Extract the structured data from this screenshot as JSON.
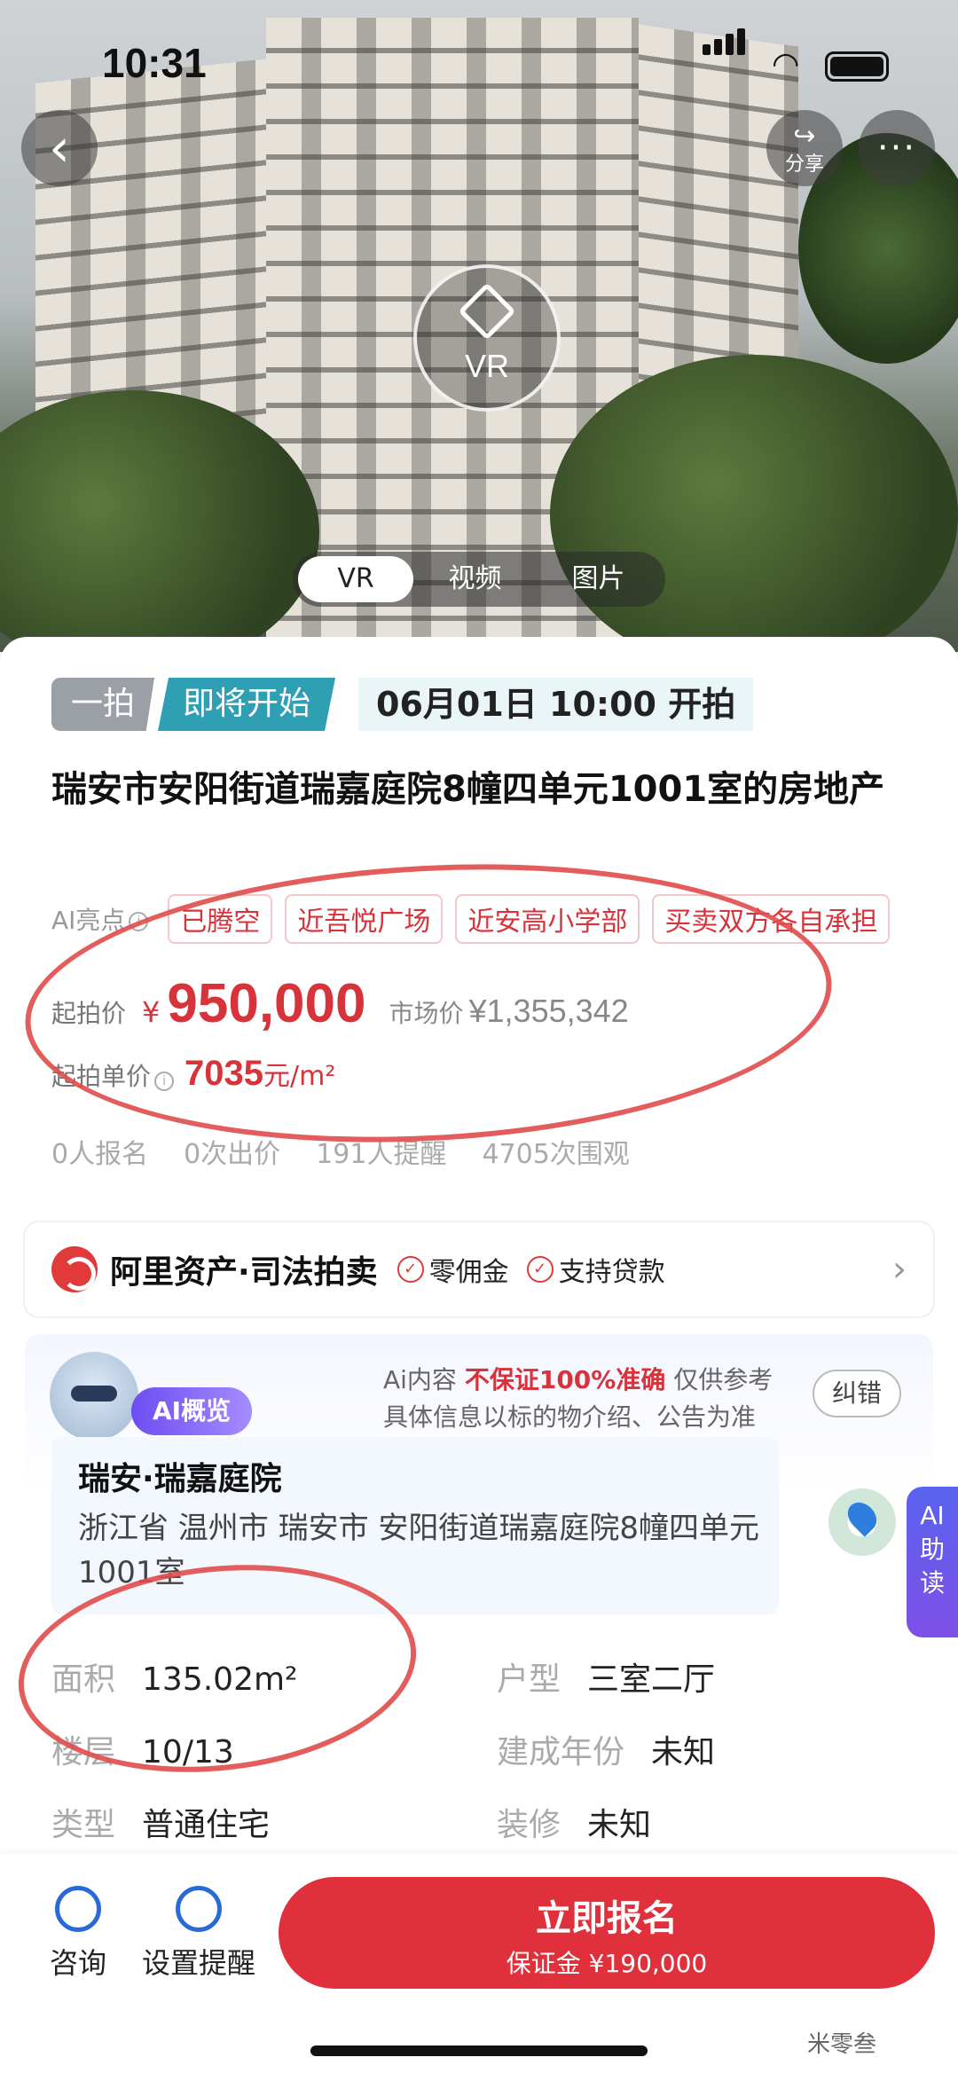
{
  "status_bar": {
    "time": "10:31"
  },
  "hero": {
    "share_label": "分享",
    "more_label": "···",
    "vr_label": "VR",
    "tabs": [
      {
        "label": "VR"
      },
      {
        "label": "视频"
      },
      {
        "label": "图片"
      }
    ]
  },
  "auction": {
    "round_tag": "一拍",
    "status_tag": "即将开始",
    "start_time": "06月01日 10:00 开拍",
    "title": "瑞安市安阳街道瑞嘉庭院8幢四单元1001室的房地产",
    "highlights_label": "AI亮点",
    "highlights": [
      "已腾空",
      "近吾悦广场",
      "近安高小学部",
      "买卖双方各自承担"
    ],
    "start_price_label": "起拍价",
    "currency": "¥",
    "start_price": "950,000",
    "market_price_label": "市场价",
    "market_price": "¥1,355,342",
    "unit_price_label": "起拍单价",
    "unit_price": "7035",
    "unit_price_unit": "元/m²",
    "stats": [
      "0人报名",
      "0次出价",
      "191人提醒",
      "4705次围观"
    ]
  },
  "platform": {
    "brand": "阿里资产·司法拍卖",
    "features": [
      "零佣金",
      "支持贷款"
    ]
  },
  "ai_overview": {
    "badge": "AI概览",
    "note_prefix": "Ai内容",
    "note_emph": "不保证100%准确",
    "note_suffix": "仅供参考",
    "note_line2": "具体信息以标的物介绍、公告为准",
    "correct_label": "纠错",
    "community": "瑞安·瑞嘉庭院",
    "address": "浙江省 温州市 瑞安市 安阳街道瑞嘉庭院8幢四单元1001室",
    "attributes": [
      {
        "key": "面积",
        "value": "135.02m²"
      },
      {
        "key": "户型",
        "value": "三室二厅"
      },
      {
        "key": "楼层",
        "value": "10/13"
      },
      {
        "key": "建成年份",
        "value": "未知"
      },
      {
        "key": "类型",
        "value": "普通住宅"
      },
      {
        "key": "装修",
        "value": "未知"
      }
    ],
    "side_tab": [
      "AI",
      "助",
      "读"
    ]
  },
  "bottom_bar": {
    "consult_label": "咨询",
    "remind_label": "设置提醒",
    "signup_label": "立即报名",
    "deposit_label": "保证金 ¥190,000"
  },
  "watermark": "米零叁"
}
